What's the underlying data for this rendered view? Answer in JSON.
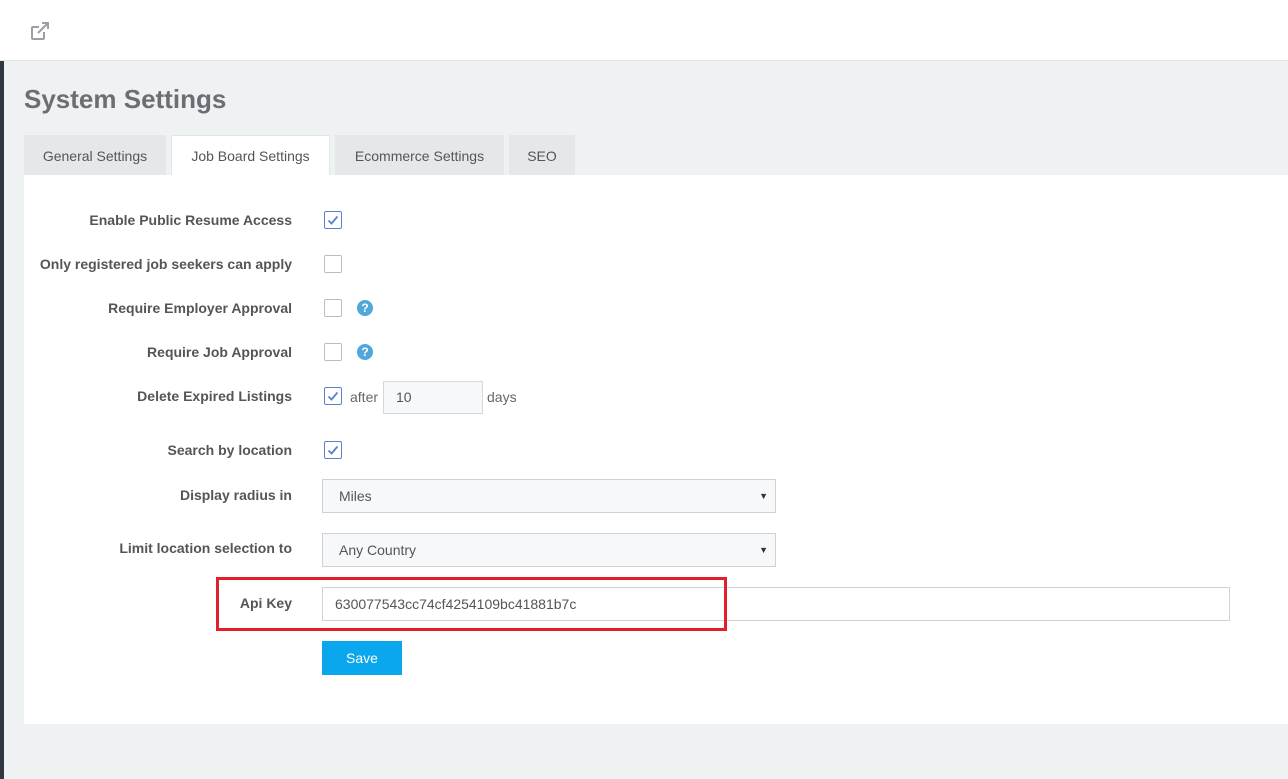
{
  "header": {
    "external_link_icon": "external-link-icon"
  },
  "page": {
    "title": "System Settings"
  },
  "tabs": [
    {
      "label": "General Settings",
      "active": false
    },
    {
      "label": "Job Board Settings",
      "active": true
    },
    {
      "label": "Ecommerce Settings",
      "active": false
    },
    {
      "label": "SEO",
      "active": false
    }
  ],
  "form": {
    "enable_public_resume": {
      "label": "Enable Public Resume Access",
      "checked": true
    },
    "only_registered": {
      "label": "Only registered job seekers can apply",
      "checked": false
    },
    "require_employer_approval": {
      "label": "Require Employer Approval",
      "checked": false,
      "help_icon": "question-circle-icon"
    },
    "require_job_approval": {
      "label": "Require Job Approval",
      "checked": false,
      "help_icon": "question-circle-icon"
    },
    "delete_expired": {
      "label": "Delete Expired Listings",
      "checked": true,
      "prefix": "after",
      "value": "10",
      "suffix": "days"
    },
    "search_by_location": {
      "label": "Search by location",
      "checked": true
    },
    "display_radius": {
      "label": "Display radius in",
      "selected": "Miles"
    },
    "limit_location": {
      "label": "Limit location selection to",
      "selected": "Any Country"
    },
    "api_key": {
      "label": "Api Key",
      "value": "630077543cc74cf4254109bc41881b7c"
    },
    "save_label": "Save"
  },
  "colors": {
    "accent": "#0aa7ef",
    "highlight": "#e0202a",
    "checkbox": "#5b7fd1",
    "help": "#4fa8d8"
  }
}
